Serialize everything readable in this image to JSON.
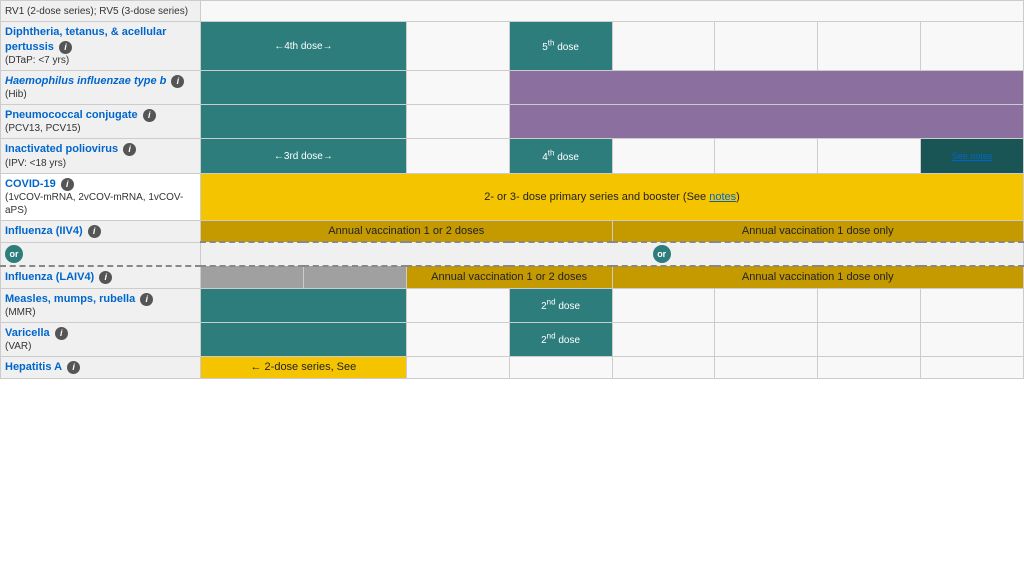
{
  "table": {
    "rows": [
      {
        "id": "rotavirus",
        "name": null,
        "nameLink": null,
        "sub": "RV1 (2-dose series); RV5 (3-dose series)",
        "cells": [
          "empty",
          "empty",
          "empty",
          "empty",
          "empty",
          "empty",
          "empty",
          "empty"
        ]
      },
      {
        "id": "dtap",
        "name": "Diphtheria, tetanus, & acellular pertussis",
        "nameLink": true,
        "sub": "(DTaP: <7 yrs)",
        "cells": [
          "arrow4th",
          "empty",
          "empty",
          "5th",
          "empty",
          "empty",
          "empty",
          "empty"
        ]
      },
      {
        "id": "hib",
        "name": "Haemophilus influenzae type b",
        "nameLink": false,
        "italic": true,
        "sub": "(Hib)",
        "cells": [
          "teal",
          "empty",
          "purple_wide"
        ]
      },
      {
        "id": "pcv",
        "name": "Pneumococcal conjugate",
        "nameLink": false,
        "sub": "(PCV13, PCV15)",
        "cells": [
          "teal",
          "empty",
          "purple_wide"
        ]
      },
      {
        "id": "ipv",
        "name": "Inactivated poliovirus",
        "nameLink": false,
        "sub": "(IPV: <18 yrs)",
        "cells": [
          "arrow3rd",
          "empty",
          "4th",
          "empty",
          "empty",
          "empty",
          "empty",
          "seenotes"
        ]
      },
      {
        "id": "covid",
        "name": "COVID-19",
        "nameLink": true,
        "sub": "(1vCOV-mRNA, 2vCOV-mRNA, 1vCOV-aPS)",
        "cells": [
          "covid_wide"
        ]
      },
      {
        "id": "influenza_iiv4",
        "name": "Influenza (IIV4)",
        "nameLink": false,
        "cells": [
          "annual12_wide",
          "annual1only_wide"
        ]
      },
      {
        "id": "influenza_laiv4",
        "name": "Influenza (LAIV4)",
        "nameLink": false,
        "cells": [
          "gray1",
          "gray2",
          "annual12_laiv",
          "annual1only_laiv"
        ]
      },
      {
        "id": "mmr",
        "name": "Measles, mumps, rubella",
        "nameLink": false,
        "sub": "(MMR)",
        "cells": [
          "teal",
          "empty",
          "2nd_dose",
          "empty",
          "empty",
          "empty",
          "empty",
          "empty"
        ]
      },
      {
        "id": "varicella",
        "name": "Varicella",
        "nameLink": false,
        "sub": "(VAR)",
        "cells": [
          "teal",
          "empty",
          "2nd_dose",
          "empty",
          "empty",
          "empty",
          "empty",
          "empty"
        ]
      },
      {
        "id": "hepa",
        "name": "Hepatitis A",
        "nameLink": false,
        "cells": [
          "hepa_2dose",
          "empty",
          "empty",
          "empty",
          "empty",
          "empty",
          "empty"
        ]
      }
    ],
    "labels": {
      "dtap_arrow": "←4th dose→",
      "dtap_5th": "5th dose",
      "ipv_arrow": "←3rd dose→",
      "ipv_4th": "4th dose",
      "ipv_seenotes": "See notes",
      "covid_text": "2- or 3- dose primary series and booster (See notes)",
      "annual12": "Annual vaccination 1 or 2 doses",
      "annual1only": "Annual vaccination 1 dose only",
      "annual12_laiv": "Annual vaccination 1 or 2 doses",
      "annual1only_laiv": "Annual vaccination 1 dose only",
      "mmr_2nd": "2nd dose",
      "var_2nd": "2nd dose",
      "hepa_text": "← 2-dose series, See",
      "or_label": "or"
    }
  }
}
